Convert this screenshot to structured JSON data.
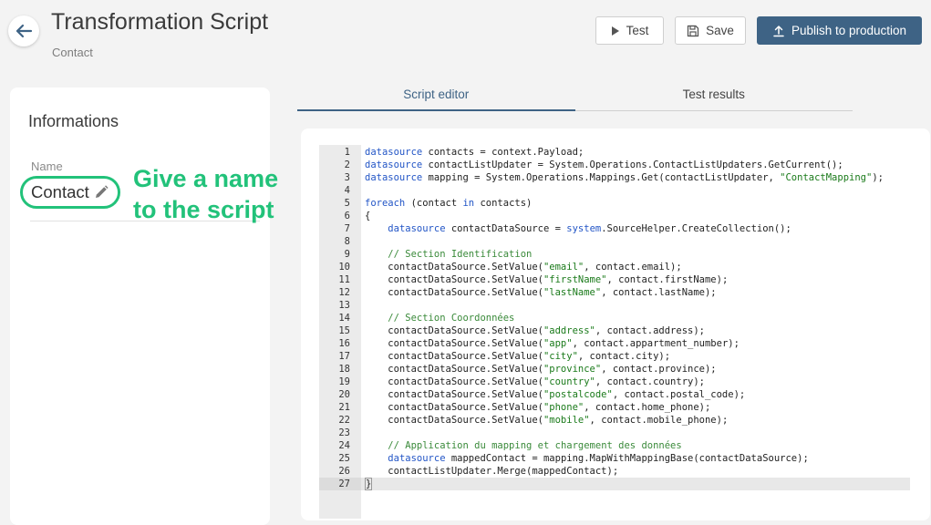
{
  "header": {
    "title": "Transformation Script",
    "subtitle": "Contact"
  },
  "toolbar": {
    "test_label": "Test",
    "save_label": "Save",
    "publish_label": "Publish to production"
  },
  "info_panel": {
    "heading": "Informations",
    "name_label": "Name",
    "name_value": "Contact"
  },
  "annotation": {
    "text": "Give a name\nto the script",
    "color": "#22c27a"
  },
  "tabs": [
    {
      "label": "Script editor",
      "active": true
    },
    {
      "label": "Test results",
      "active": false
    }
  ],
  "colors": {
    "accent": "#3e6385",
    "keyword": "#2255c6",
    "string": "#1a7a1a",
    "comment": "#3a8a3a",
    "annotation": "#22c27a"
  },
  "editor": {
    "current_line": 27,
    "lines": [
      "datasource contacts = context.Payload;",
      "datasource contactListUpdater = System.Operations.ContactListUpdaters.GetCurrent();",
      "datasource mapping = System.Operations.Mappings.Get(contactListUpdater, \"ContactMapping\");",
      "",
      "foreach (contact in contacts)",
      "{",
      "    datasource contactDataSource = system.SourceHelper.CreateCollection();",
      "",
      "    // Section Identification",
      "    contactDataSource.SetValue(\"email\", contact.email);",
      "    contactDataSource.SetValue(\"firstName\", contact.firstName);",
      "    contactDataSource.SetValue(\"lastName\", contact.lastName);",
      "",
      "    // Section Coordonnées",
      "    contactDataSource.SetValue(\"address\", contact.address);",
      "    contactDataSource.SetValue(\"app\", contact.appartment_number);",
      "    contactDataSource.SetValue(\"city\", contact.city);",
      "    contactDataSource.SetValue(\"province\", contact.province);",
      "    contactDataSource.SetValue(\"country\", contact.country);",
      "    contactDataSource.SetValue(\"postalcode\", contact.postal_code);",
      "    contactDataSource.SetValue(\"phone\", contact.home_phone);",
      "    contactDataSource.SetValue(\"mobile\", contact.mobile_phone);",
      "",
      "    // Application du mapping et chargement des données",
      "    datasource mappedContact = mapping.MapWithMappingBase(contactDataSource);",
      "    contactListUpdater.Merge(mappedContact);",
      "}"
    ]
  }
}
